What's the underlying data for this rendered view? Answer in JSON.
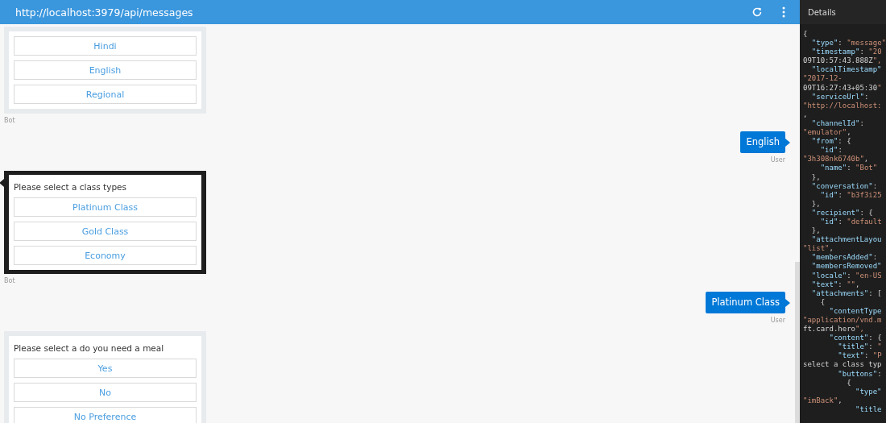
{
  "header": {
    "url": "http://localhost:3979/api/messages"
  },
  "messages": [
    {
      "kind": "card",
      "selected": false,
      "buttons": [
        "Hindi",
        "English",
        "Regional"
      ],
      "sender": "Bot"
    },
    {
      "kind": "user",
      "text": "English",
      "sender": "User"
    },
    {
      "kind": "card",
      "selected": true,
      "title": "Please select a class types",
      "buttons": [
        "Platinum Class",
        "Gold Class",
        "Economy"
      ],
      "sender": "Bot"
    },
    {
      "kind": "user",
      "text": "Platinum Class",
      "sender": "User"
    },
    {
      "kind": "card",
      "selected": false,
      "title": "Please select a do you need a meal",
      "buttons": [
        "Yes",
        "No",
        "No Preference"
      ]
    }
  ],
  "details": {
    "title": "Details",
    "lines": [
      "{",
      "  \"type\": \"message\"",
      "  \"timestamp\": \"20",
      "09T10:57:43.888Z\",",
      "  \"localTimestamp\"",
      "\"2017-12-",
      "09T16:27:43+05:30\"",
      "  \"serviceUrl\":",
      "\"http://localhost:",
      ",",
      "  \"channelId\":",
      "\"emulator\",",
      "  \"from\": {",
      "    \"id\":",
      "\"3h308nk6740b\",",
      "    \"name\": \"Bot\"",
      "  },",
      "  \"conversation\":",
      "    \"id\": \"b3f3i25",
      "  },",
      "  \"recipient\": {",
      "    \"id\": \"default",
      "  },",
      "  \"attachmentLayou",
      "\"list\",",
      "  \"membersAdded\":",
      "  \"membersRemoved\"",
      "  \"locale\": \"en-US",
      "  \"text\": \"\",",
      "  \"attachments\": [",
      "    {",
      "      \"contentType",
      "\"application/vnd.m",
      "ft.card.hero\",",
      "      \"content\": {",
      "        \"title\": \"",
      "        \"text\": \"P",
      "select a class typ",
      "        \"buttons\":",
      "          {",
      "            \"type\"",
      "\"imBack\",",
      "            \"title"
    ]
  }
}
